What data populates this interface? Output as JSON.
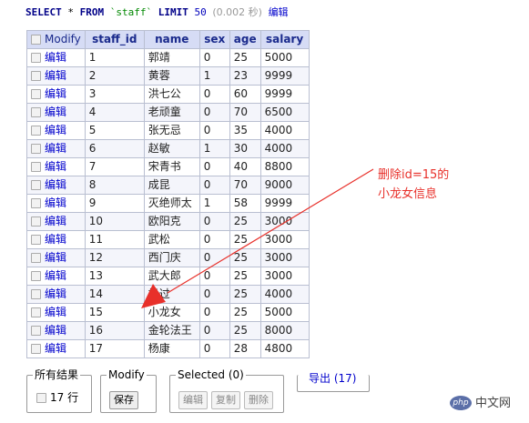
{
  "query": {
    "select": "SELECT",
    "star": "*",
    "from": "FROM",
    "table": "`staff`",
    "limit": "LIMIT",
    "limit_value": "50",
    "time": "(0.002 秒)",
    "edit_link": "编辑"
  },
  "table": {
    "header_modify": "Modify",
    "columns": [
      "staff_id",
      "name",
      "sex",
      "age",
      "salary"
    ],
    "edit_label": "编辑",
    "rows": [
      {
        "staff_id": "1",
        "name": "郭靖",
        "sex": "0",
        "age": "25",
        "salary": "5000"
      },
      {
        "staff_id": "2",
        "name": "黄蓉",
        "sex": "1",
        "age": "23",
        "salary": "9999"
      },
      {
        "staff_id": "3",
        "name": "洪七公",
        "sex": "0",
        "age": "60",
        "salary": "9999"
      },
      {
        "staff_id": "4",
        "name": "老顽童",
        "sex": "0",
        "age": "70",
        "salary": "6500"
      },
      {
        "staff_id": "5",
        "name": "张无忌",
        "sex": "0",
        "age": "35",
        "salary": "4000"
      },
      {
        "staff_id": "6",
        "name": "赵敏",
        "sex": "1",
        "age": "30",
        "salary": "4000"
      },
      {
        "staff_id": "7",
        "name": "宋青书",
        "sex": "0",
        "age": "40",
        "salary": "8800"
      },
      {
        "staff_id": "8",
        "name": "成昆",
        "sex": "0",
        "age": "70",
        "salary": "9000"
      },
      {
        "staff_id": "9",
        "name": "灭绝师太",
        "sex": "1",
        "age": "58",
        "salary": "9999"
      },
      {
        "staff_id": "10",
        "name": "欧阳克",
        "sex": "0",
        "age": "25",
        "salary": "3000"
      },
      {
        "staff_id": "11",
        "name": "武松",
        "sex": "0",
        "age": "25",
        "salary": "3000"
      },
      {
        "staff_id": "12",
        "name": "西门庆",
        "sex": "0",
        "age": "25",
        "salary": "3000"
      },
      {
        "staff_id": "13",
        "name": "武大郎",
        "sex": "0",
        "age": "25",
        "salary": "3000"
      },
      {
        "staff_id": "14",
        "name": "杨过",
        "sex": "0",
        "age": "25",
        "salary": "4000"
      },
      {
        "staff_id": "15",
        "name": "小龙女",
        "sex": "0",
        "age": "25",
        "salary": "5000"
      },
      {
        "staff_id": "16",
        "name": "金轮法王",
        "sex": "0",
        "age": "25",
        "salary": "8000"
      },
      {
        "staff_id": "17",
        "name": "杨康",
        "sex": "0",
        "age": "28",
        "salary": "4800"
      }
    ]
  },
  "footer": {
    "all_results_legend": "所有结果",
    "rows_count": "17 行",
    "modify_legend": "Modify",
    "save_button": "保存",
    "selected_legend": "Selected (0)",
    "edit_button": "编辑",
    "copy_button": "复制",
    "delete_button": "删除",
    "export_link": "导出 (17)"
  },
  "annotation": {
    "text": "删除id=15的小龙女信息",
    "color": "#e8302a"
  },
  "watermark": {
    "badge": "php",
    "site": "中文网"
  }
}
